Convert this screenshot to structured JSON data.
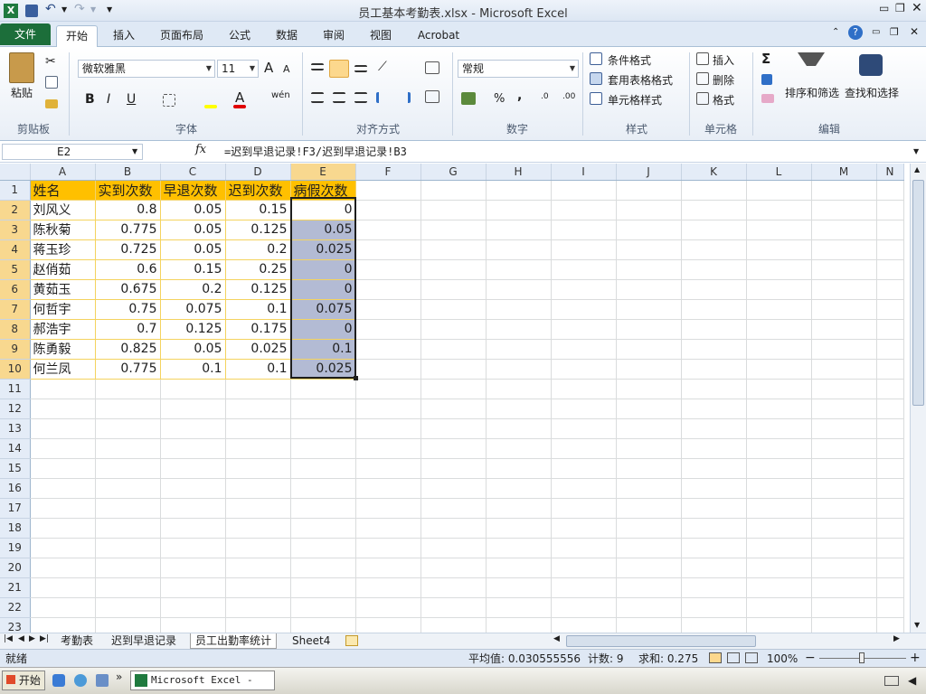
{
  "window": {
    "title": "员工基本考勤表.xlsx - Microsoft Excel"
  },
  "ribbon_tabs": [
    "文件",
    "开始",
    "插入",
    "页面布局",
    "公式",
    "数据",
    "审阅",
    "视图",
    "Acrobat"
  ],
  "active_tab": "开始",
  "clipboard": {
    "paste": "粘贴",
    "group": "剪贴板"
  },
  "font": {
    "name": "微软雅黑",
    "size": "11",
    "bold": "B",
    "italic": "I",
    "underline": "U",
    "group": "字体",
    "grow": "A",
    "shrink": "A",
    "font_color": "A",
    "phonetic": "wén"
  },
  "alignment": {
    "group": "对齐方式"
  },
  "number": {
    "format": "常规",
    "percent": "%",
    "comma": ",",
    "group": "数字"
  },
  "styles": {
    "conditional": "条件格式",
    "table": "套用表格格式",
    "cell": "单元格样式",
    "group": "样式"
  },
  "cells": {
    "insert": "插入",
    "delete": "删除",
    "format": "格式",
    "group": "单元格"
  },
  "editing": {
    "sort": "排序和筛选",
    "find": "查找和选择",
    "group": "编辑",
    "sigma": "Σ"
  },
  "name_box": "E2",
  "fx": "fx",
  "formula": "=迟到早退记录!F3/迟到早退记录!B3",
  "columns": [
    "A",
    "B",
    "C",
    "D",
    "E",
    "F",
    "G",
    "H",
    "I",
    "J",
    "K",
    "L",
    "M",
    "N"
  ],
  "header_row": [
    "姓名",
    "实到次数",
    "早退次数",
    "迟到次数",
    "病假次数"
  ],
  "rows": [
    [
      "刘风义",
      "0.8",
      "0.05",
      "0.15",
      "0"
    ],
    [
      "陈秋菊",
      "0.775",
      "0.05",
      "0.125",
      "0.05"
    ],
    [
      "蒋玉珍",
      "0.725",
      "0.05",
      "0.2",
      "0.025"
    ],
    [
      "赵俏茹",
      "0.6",
      "0.15",
      "0.25",
      "0"
    ],
    [
      "黄茹玉",
      "0.675",
      "0.2",
      "0.125",
      "0"
    ],
    [
      "何哲宇",
      "0.75",
      "0.075",
      "0.1",
      "0.075"
    ],
    [
      "郝浩宇",
      "0.7",
      "0.125",
      "0.175",
      "0"
    ],
    [
      "陈勇毅",
      "0.825",
      "0.05",
      "0.025",
      "0.1"
    ],
    [
      "何兰凤",
      "0.775",
      "0.1",
      "0.1",
      "0.025"
    ]
  ],
  "row_numbers": [
    "1",
    "2",
    "3",
    "4",
    "5",
    "6",
    "7",
    "8",
    "9",
    "10",
    "11",
    "12",
    "13",
    "14",
    "15",
    "16",
    "17",
    "18",
    "19",
    "20",
    "21",
    "22",
    "23"
  ],
  "sheets": [
    "考勤表",
    "迟到早退记录",
    "员工出勤率统计",
    "Sheet4"
  ],
  "active_sheet": "员工出勤率统计",
  "status": {
    "ready": "就绪",
    "average": "平均值: 0.030555556",
    "count": "计数: 9",
    "sum": "求和: 0.275",
    "zoom": "100%",
    "minus": "−",
    "plus": "+"
  },
  "taskbar": {
    "start": "开始",
    "app": "Microsoft Excel - ..."
  },
  "colors": {
    "header_fill": "#ffc000",
    "selection": "#b3bbd4",
    "file_tab": "#1c6e3a"
  }
}
